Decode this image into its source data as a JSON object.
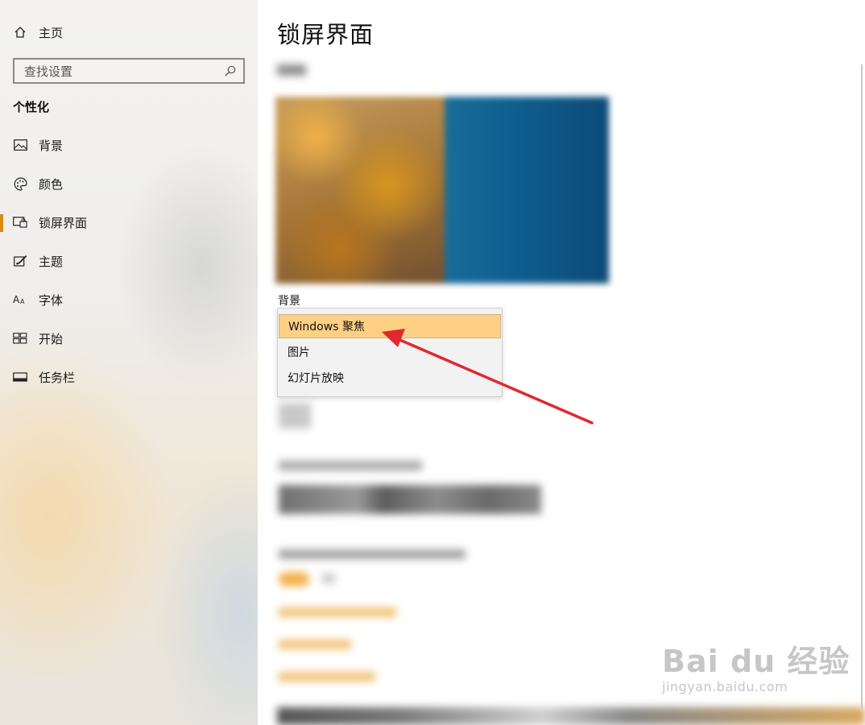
{
  "sidebar": {
    "home_label": "主页",
    "search_placeholder": "查找设置",
    "section_title": "个性化",
    "items": [
      {
        "label": "背景",
        "icon": "image-icon"
      },
      {
        "label": "颜色",
        "icon": "palette-icon"
      },
      {
        "label": "锁屏界面",
        "icon": "lock-screen-icon",
        "active": true
      },
      {
        "label": "主题",
        "icon": "theme-brush-icon"
      },
      {
        "label": "字体",
        "icon": "font-icon"
      },
      {
        "label": "开始",
        "icon": "start-icon"
      },
      {
        "label": "任务栏",
        "icon": "taskbar-icon"
      }
    ]
  },
  "main": {
    "title": "锁屏界面",
    "background_label": "背景",
    "dropdown": {
      "options": [
        "Windows 聚焦",
        "图片",
        "幻灯片放映"
      ],
      "selected": "Windows 聚焦"
    }
  },
  "watermark": {
    "text": "Bai du 经验",
    "sub": "jingyan.baidu.com"
  },
  "colors": {
    "accent": "#d98a1a",
    "selected_option": "#ffd084",
    "arrow": "#e0282e"
  }
}
